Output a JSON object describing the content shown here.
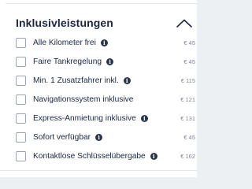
{
  "section": {
    "title": "Inklusivleistungen",
    "collapse_icon": "chevron-up-icon"
  },
  "items": [
    {
      "label": "Alle Kilometer frei",
      "info_glyph": "i",
      "price": "€ 45"
    },
    {
      "label": "Faire Tankregelung",
      "info_glyph": "i",
      "price": "€ 45"
    },
    {
      "label": "Min. 1 Zusatzfahrer inkl.",
      "info_glyph": "i",
      "price": "€ 115"
    },
    {
      "label": "Navigationssystem inklusive",
      "price": "€ 121"
    },
    {
      "label": "Express-Anmietung inklusive",
      "info_glyph": "i",
      "price": "€ 131"
    },
    {
      "label": "Sofort verfügbar",
      "info_glyph": "i",
      "price": "€ 45"
    },
    {
      "label": "Kontaktlose Schlüsselübergabe",
      "info_glyph": "i",
      "price": "€ 162"
    }
  ],
  "colors": {
    "text": "#1a2742",
    "price": "#7d8698",
    "checkbox_border": "#9aa4b5",
    "background": "#ecf0f3"
  }
}
